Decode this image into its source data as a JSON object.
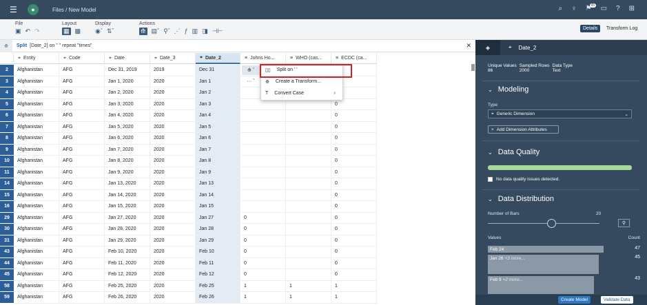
{
  "shell": {
    "breadcrumb": "Files  /  New Model",
    "badge": "45"
  },
  "toolbar": {
    "groups": [
      {
        "label": "File"
      },
      {
        "label": "Layout"
      },
      {
        "label": "Display"
      },
      {
        "label": "Actions"
      }
    ],
    "details_label": "Details",
    "transform_log_label": "Transform Log"
  },
  "formula": {
    "prefix": "Split",
    "body": "[Date_2] on \" \" repeat \"times\""
  },
  "grid": {
    "columns": [
      "Entity",
      "Code",
      "Date",
      "Date_3",
      "Date_2",
      "Johns Ho...",
      "WHO (cas...",
      "ECDC (ca..."
    ],
    "rows": [
      {
        "n": "2",
        "c": [
          "Afghanistan",
          "AFG",
          "Dec 31, 2019",
          "2019",
          "Dec 31",
          "",
          "",
          ""
        ]
      },
      {
        "n": "3",
        "c": [
          "Afghanistan",
          "AFG",
          "Jan 1, 2020",
          "2020",
          "Jan 1",
          "",
          "",
          "0"
        ]
      },
      {
        "n": "4",
        "c": [
          "Afghanistan",
          "AFG",
          "Jan 2, 2020",
          "2020",
          "Jan 2",
          "",
          "",
          "0"
        ]
      },
      {
        "n": "5",
        "c": [
          "Afghanistan",
          "AFG",
          "Jan 3, 2020",
          "2020",
          "Jan 3",
          "",
          "",
          "0"
        ]
      },
      {
        "n": "6",
        "c": [
          "Afghanistan",
          "AFG",
          "Jan 4, 2020",
          "2020",
          "Jan 4",
          "",
          "",
          "0"
        ]
      },
      {
        "n": "7",
        "c": [
          "Afghanistan",
          "AFG",
          "Jan 5, 2020",
          "2020",
          "Jan 5",
          "",
          "",
          "0"
        ]
      },
      {
        "n": "8",
        "c": [
          "Afghanistan",
          "AFG",
          "Jan 6, 2020",
          "2020",
          "Jan 6",
          "",
          "",
          "0"
        ]
      },
      {
        "n": "9",
        "c": [
          "Afghanistan",
          "AFG",
          "Jan 7, 2020",
          "2020",
          "Jan 7",
          "",
          "",
          "0"
        ]
      },
      {
        "n": "10",
        "c": [
          "Afghanistan",
          "AFG",
          "Jan 8, 2020",
          "2020",
          "Jan 8",
          "",
          "",
          "0"
        ]
      },
      {
        "n": "11",
        "c": [
          "Afghanistan",
          "AFG",
          "Jan 9, 2020",
          "2020",
          "Jan 9",
          "",
          "",
          "0"
        ]
      },
      {
        "n": "14",
        "c": [
          "Afghanistan",
          "AFG",
          "Jan 13, 2020",
          "2020",
          "Jan 13",
          "",
          "",
          "0"
        ]
      },
      {
        "n": "15",
        "c": [
          "Afghanistan",
          "AFG",
          "Jan 14, 2020",
          "2020",
          "Jan 14",
          "",
          "",
          "0"
        ]
      },
      {
        "n": "16",
        "c": [
          "Afghanistan",
          "AFG",
          "Jan 15, 2020",
          "2020",
          "Jan 15",
          "",
          "",
          "0"
        ]
      },
      {
        "n": "29",
        "c": [
          "Afghanistan",
          "AFG",
          "Jan 27, 2020",
          "2020",
          "Jan 27",
          "0",
          "",
          "0"
        ]
      },
      {
        "n": "30",
        "c": [
          "Afghanistan",
          "AFG",
          "Jan 28, 2020",
          "2020",
          "Jan 28",
          "0",
          "",
          "0"
        ]
      },
      {
        "n": "31",
        "c": [
          "Afghanistan",
          "AFG",
          "Jan 29, 2020",
          "2020",
          "Jan 29",
          "0",
          "",
          "0"
        ]
      },
      {
        "n": "43",
        "c": [
          "Afghanistan",
          "AFG",
          "Feb 10, 2020",
          "2020",
          "Feb 10",
          "0",
          "",
          "0"
        ]
      },
      {
        "n": "44",
        "c": [
          "Afghanistan",
          "AFG",
          "Feb 11, 2020",
          "2020",
          "Feb 11",
          "0",
          "",
          "0"
        ]
      },
      {
        "n": "45",
        "c": [
          "Afghanistan",
          "AFG",
          "Feb 12, 2020",
          "2020",
          "Feb 12",
          "0",
          "",
          "0"
        ]
      },
      {
        "n": "58",
        "c": [
          "Afghanistan",
          "AFG",
          "Feb 25, 2020",
          "2020",
          "Feb 25",
          "1",
          "1",
          "1"
        ]
      },
      {
        "n": "59",
        "c": [
          "Afghanistan",
          "AFG",
          "Feb 26, 2020",
          "2020",
          "Feb 26",
          "1",
          "1",
          "1"
        ]
      }
    ]
  },
  "context_menu": {
    "items": [
      "Split on ' '",
      "Create a Transform...",
      "Convert Case"
    ]
  },
  "panel": {
    "tab_label": "Date_2",
    "stats": [
      {
        "label": "Unique Values",
        "value": "86"
      },
      {
        "label": "Sampled Rows",
        "value": "2000"
      },
      {
        "label": "Data Type",
        "value": "Text"
      }
    ],
    "modeling": {
      "title": "Modeling",
      "type_label": "Type",
      "type_value": "Generic Dimension",
      "add_button": "Add Dimension Attributes"
    },
    "quality": {
      "title": "Data Quality",
      "message": "No data quality issues detected."
    },
    "distribution": {
      "title": "Data Distribution",
      "bars_label": "Number of Bars",
      "bars_value": "20",
      "values_label": "Values",
      "count_label": "Count",
      "bars": [
        {
          "label": "Feb 24",
          "more": "",
          "count": "47"
        },
        {
          "label": "Jan 26",
          "more": "+3 more...",
          "count": "45"
        },
        {
          "label": "Feb 9",
          "more": "+2 more...",
          "count": "43"
        }
      ]
    },
    "create_model": "Create Model",
    "validate_data": "Validate Data"
  }
}
